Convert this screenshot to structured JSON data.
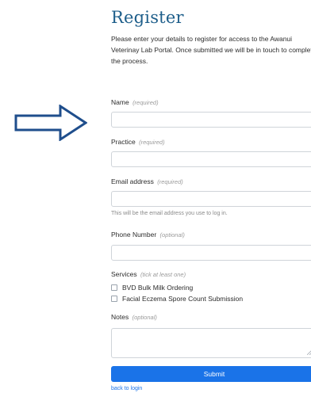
{
  "title": "Register",
  "intro": "Please enter your details to register for access to the Awanui Veterinay Lab Portal. Once submitted we will be in touch to complete the process.",
  "fields": {
    "name": {
      "label": "Name",
      "hint": "(required)",
      "value": ""
    },
    "practice": {
      "label": "Practice",
      "hint": "(required)",
      "value": ""
    },
    "email": {
      "label": "Email address",
      "hint": "(required)",
      "value": "",
      "helper": "This will be the email address you use to log in."
    },
    "phone": {
      "label": "Phone Number",
      "hint": "(optional)",
      "value": ""
    },
    "services": {
      "label": "Services",
      "hint": "(tick at least one)",
      "options": [
        {
          "label": "BVD Bulk Milk Ordering",
          "checked": false
        },
        {
          "label": "Facial Eczema Spore Count Submission",
          "checked": false
        }
      ]
    },
    "notes": {
      "label": "Notes",
      "hint": "(optional)",
      "value": ""
    }
  },
  "submit_label": "Submit",
  "back_link": "back to login",
  "colors": {
    "title": "#1f5f8b",
    "primary": "#1a73e8",
    "arrow": "#1f4e8c"
  },
  "icons": {
    "arrow": "right-arrow-icon"
  }
}
